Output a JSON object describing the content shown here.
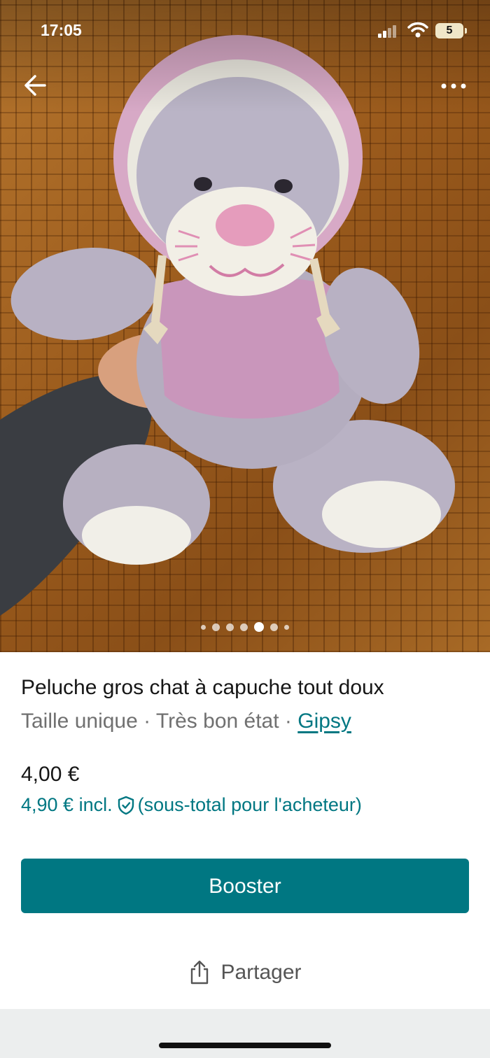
{
  "status_bar": {
    "time": "17:05",
    "battery": "5"
  },
  "icons": {
    "back": "arrow-left-icon",
    "more": "more-horizontal-icon",
    "signal": "signal-icon",
    "wifi": "wifi-icon",
    "battery": "battery-icon",
    "shield": "shield-check-icon",
    "share": "share-icon"
  },
  "gallery": {
    "photo_count": 7,
    "current_index": 5
  },
  "item": {
    "title": "Peluche gros chat à capuche tout doux",
    "size": "Taille unique",
    "condition": "Très bon état",
    "separator": " · ",
    "brand": "Gipsy",
    "price": "4,00 €",
    "price_incl": "4,90 € incl.",
    "price_incl_note": "(sous-total pour l'acheteur)"
  },
  "actions": {
    "booster": "Booster",
    "share": "Partager"
  },
  "colors": {
    "accent": "#007782",
    "text": "#161616",
    "muted": "#707070",
    "bottom_band": "#eceeee"
  }
}
